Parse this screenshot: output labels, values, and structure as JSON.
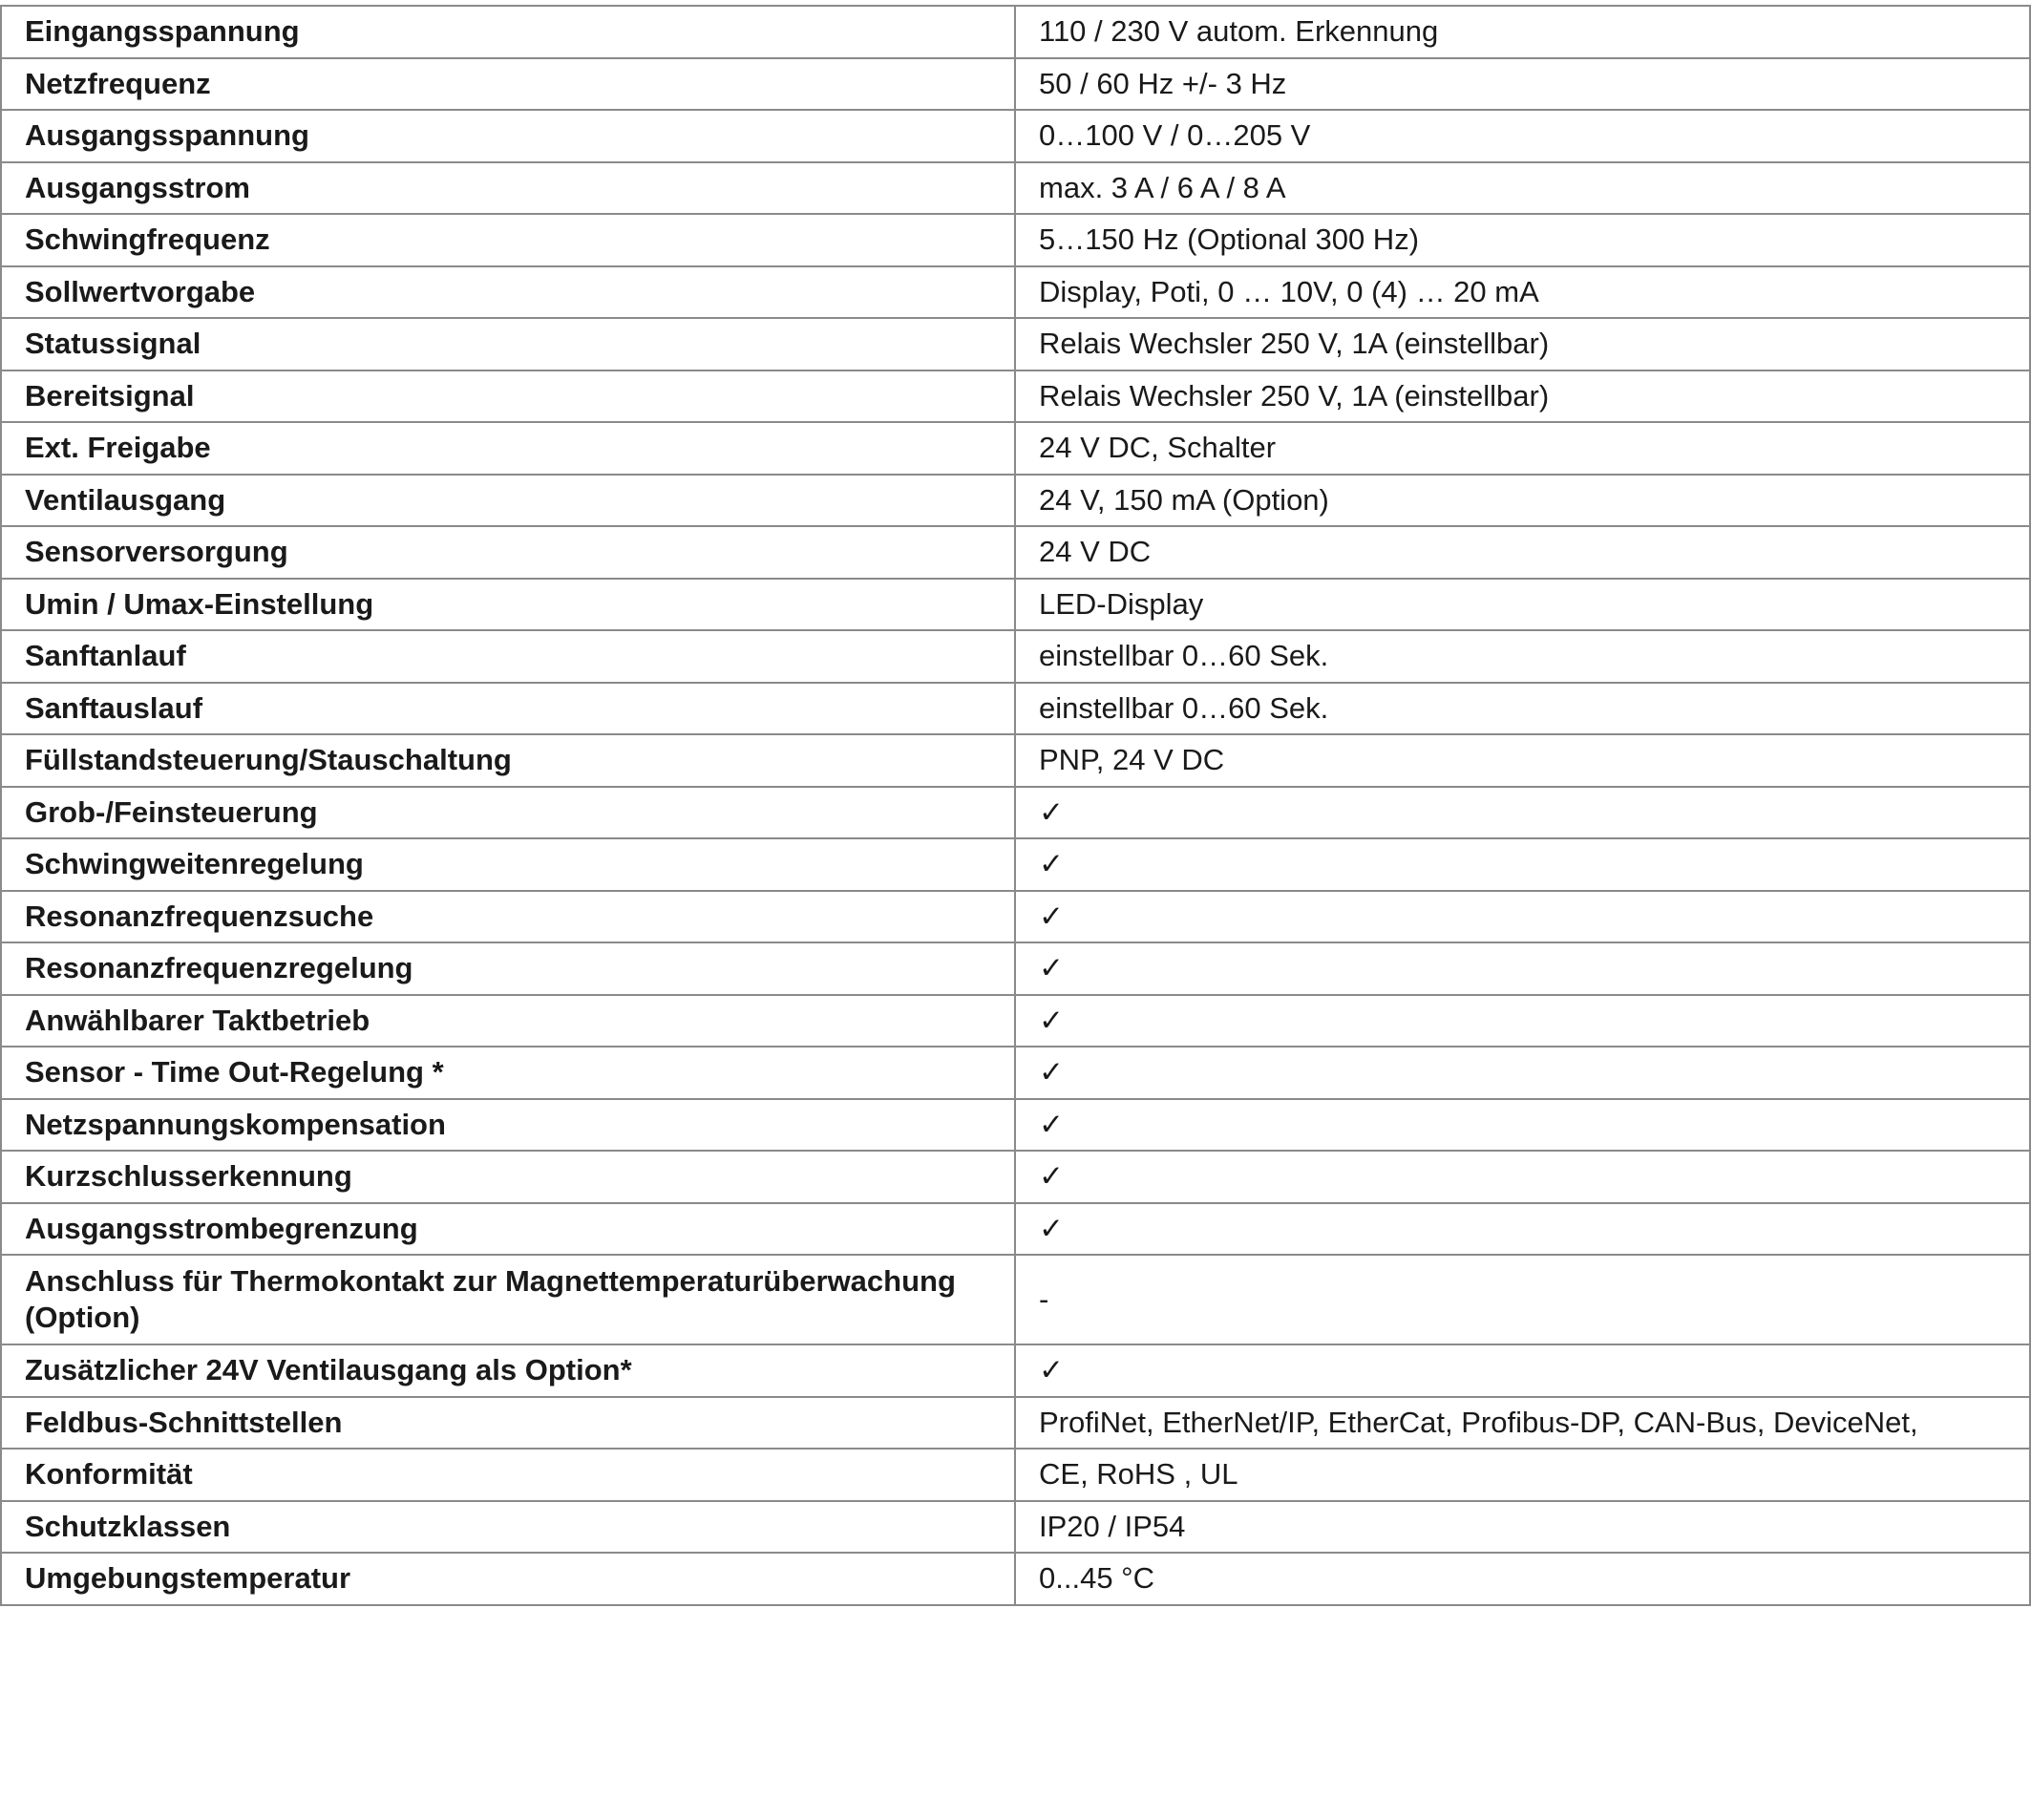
{
  "specs": [
    {
      "label": "Eingangsspannung",
      "value": "110 / 230 V autom. Erkennung"
    },
    {
      "label": "Netzfrequenz",
      "value": "50 / 60 Hz +/- 3 Hz"
    },
    {
      "label": "Ausgangsspannung",
      "value": "0…100 V / 0…205 V"
    },
    {
      "label": "Ausgangsstrom",
      "value": "max. 3 A / 6 A / 8 A"
    },
    {
      "label": "Schwingfrequenz",
      "value": "5…150 Hz (Optional 300 Hz)"
    },
    {
      "label": "Sollwertvorgabe",
      "value": "Display, Poti, 0 … 10V, 0 (4) … 20 mA"
    },
    {
      "label": "Statussignal",
      "value": "Relais Wechsler 250 V, 1A (einstellbar)"
    },
    {
      "label": "Bereitsignal",
      "value": "Relais Wechsler 250 V, 1A (einstellbar)"
    },
    {
      "label": "Ext. Freigabe",
      "value": "24 V DC, Schalter"
    },
    {
      "label": "Ventilausgang",
      "value": "24 V, 150 mA (Option)"
    },
    {
      "label": "Sensorversorgung",
      "value": "24 V DC"
    },
    {
      "label": "Umin / Umax-Einstellung",
      "value": "LED-Display"
    },
    {
      "label": "Sanftanlauf",
      "value": "einstellbar 0…60 Sek."
    },
    {
      "label": "Sanftauslauf",
      "value": "einstellbar 0…60 Sek."
    },
    {
      "label": "Füllstandsteuerung/Stauschaltung",
      "value": "PNP, 24 V DC"
    },
    {
      "label": "Grob-/Feinsteuerung",
      "value": "✓"
    },
    {
      "label": "Schwingweitenregelung",
      "value": "✓"
    },
    {
      "label": "Resonanzfrequenzsuche",
      "value": "✓"
    },
    {
      "label": "Resonanzfrequenzregelung",
      "value": "✓"
    },
    {
      "label": "Anwählbarer Taktbetrieb",
      "value": "✓"
    },
    {
      "label": "Sensor - Time Out-Regelung *",
      "value": "✓"
    },
    {
      "label": "Netzspannungskompensation",
      "value": "✓"
    },
    {
      "label": "Kurzschlusserkennung",
      "value": "✓"
    },
    {
      "label": "Ausgangsstrombegrenzung",
      "value": "✓"
    },
    {
      "label": "Anschluss für Thermokontakt zur Magnettemperaturüberwachung (Option)",
      "value": "-"
    },
    {
      "label": "Zusätzlicher 24V Ventilausgang als Option*",
      "value": "✓"
    },
    {
      "label": "Feldbus-Schnittstellen",
      "value": "ProfiNet, EtherNet/IP, EtherCat, Profibus-DP, CAN-Bus, DeviceNet,"
    },
    {
      "label": "Konformität",
      "value": "CE, RoHS , UL"
    },
    {
      "label": "Schutzklassen",
      "value": "IP20 / IP54"
    },
    {
      "label": "Umgebungstemperatur",
      "value": "0...45 °C"
    }
  ]
}
